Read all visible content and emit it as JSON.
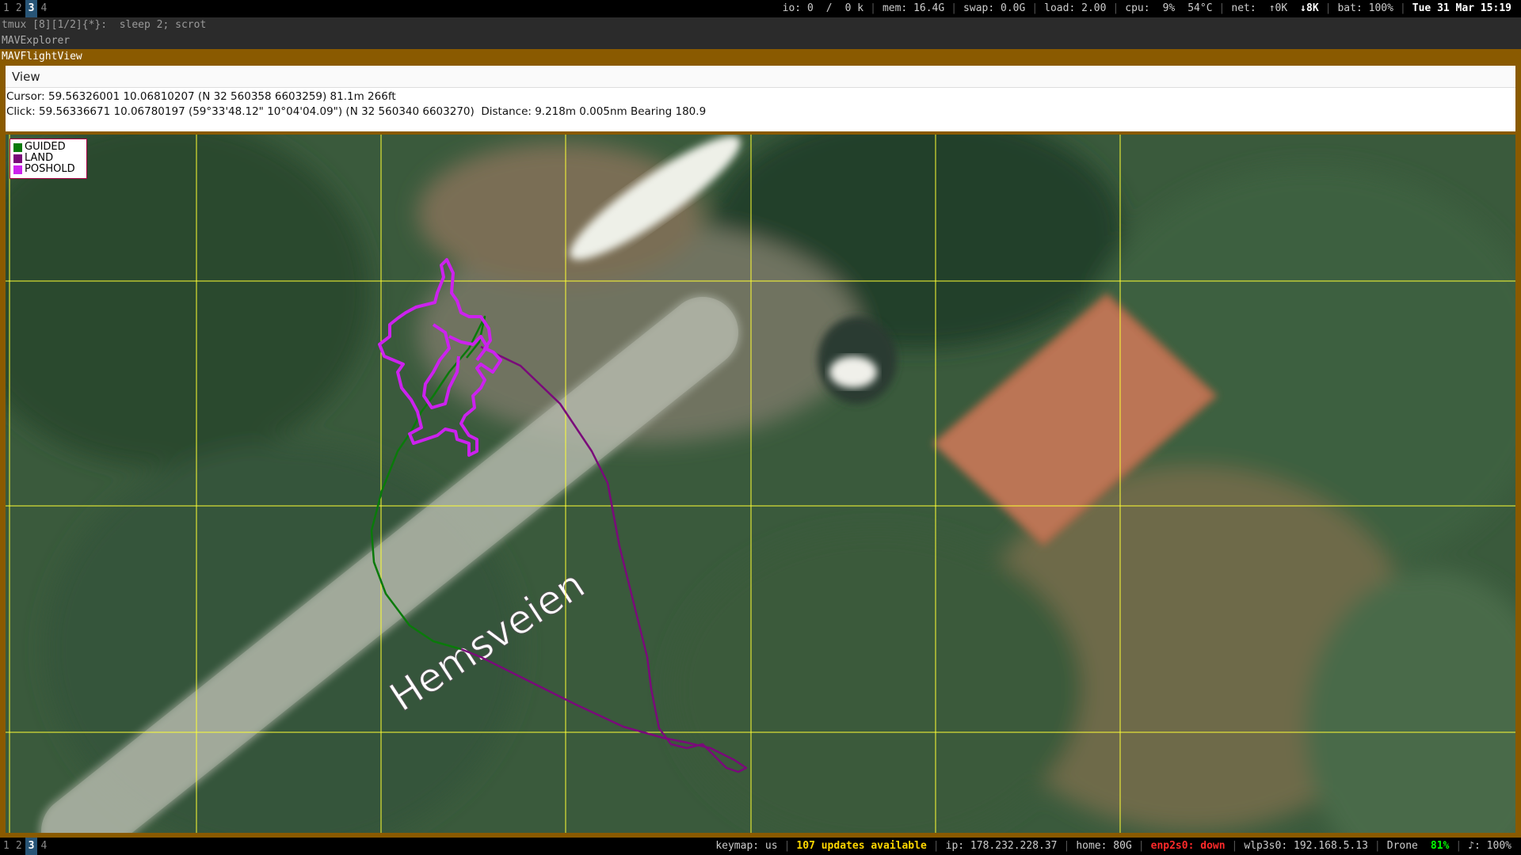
{
  "top_bar": {
    "workspaces": [
      "1",
      "2",
      "3",
      "4"
    ],
    "active_workspace": "3",
    "io": "io: 0",
    "io_rate": "/",
    "io_k": "0 k",
    "mem": "mem: 16.4G",
    "swap": "swap: 0.0G",
    "load": "load: 2.00",
    "cpu_label": "cpu:",
    "cpu": "9%",
    "temp": "54°C",
    "net_label": "net:",
    "net_up": "↑0K",
    "net_down": "↓8K",
    "battery": "bat: 100%",
    "datetime": "Tue 31 Mar 15:19"
  },
  "tmux_line": "tmux [8][1/2]{*}:  sleep 2; scrot",
  "explorer_title": "MAVExplorer",
  "flightview_title": "MAVFlightView",
  "menu": {
    "view": "View"
  },
  "info": {
    "cursor": "Cursor: 59.56326001 10.06810207 (N 32 560358 6603259) 81.1m 266ft",
    "click": "Click: 59.56336671 10.06780197 (59°33'48.12\" 10°04'04.09\") (N 32 560340 6603270)  Distance: 9.218m 0.005nm Bearing 180.9"
  },
  "legend": [
    {
      "label": "GUIDED",
      "color": "#0a7a0a"
    },
    {
      "label": "LAND",
      "color": "#7a0a7a"
    },
    {
      "label": "POSHOLD",
      "color": "#cc22ee"
    }
  ],
  "map": {
    "road_label": "Hemsveien",
    "grid_color": "#ffff33"
  },
  "bottom_bar": {
    "workspaces": [
      "1",
      "2",
      "3",
      "4"
    ],
    "active_workspace": "3",
    "keymap": "keymap: us",
    "updates": "107 updates available",
    "ip": "ip: 178.232.228.37",
    "home": "home: 80G",
    "enp": "enp2s0: down",
    "wlp": "wlp3s0: 192.168.5.13",
    "ssid": "Drone",
    "signal": "81%",
    "volume": "♪: 100%"
  }
}
